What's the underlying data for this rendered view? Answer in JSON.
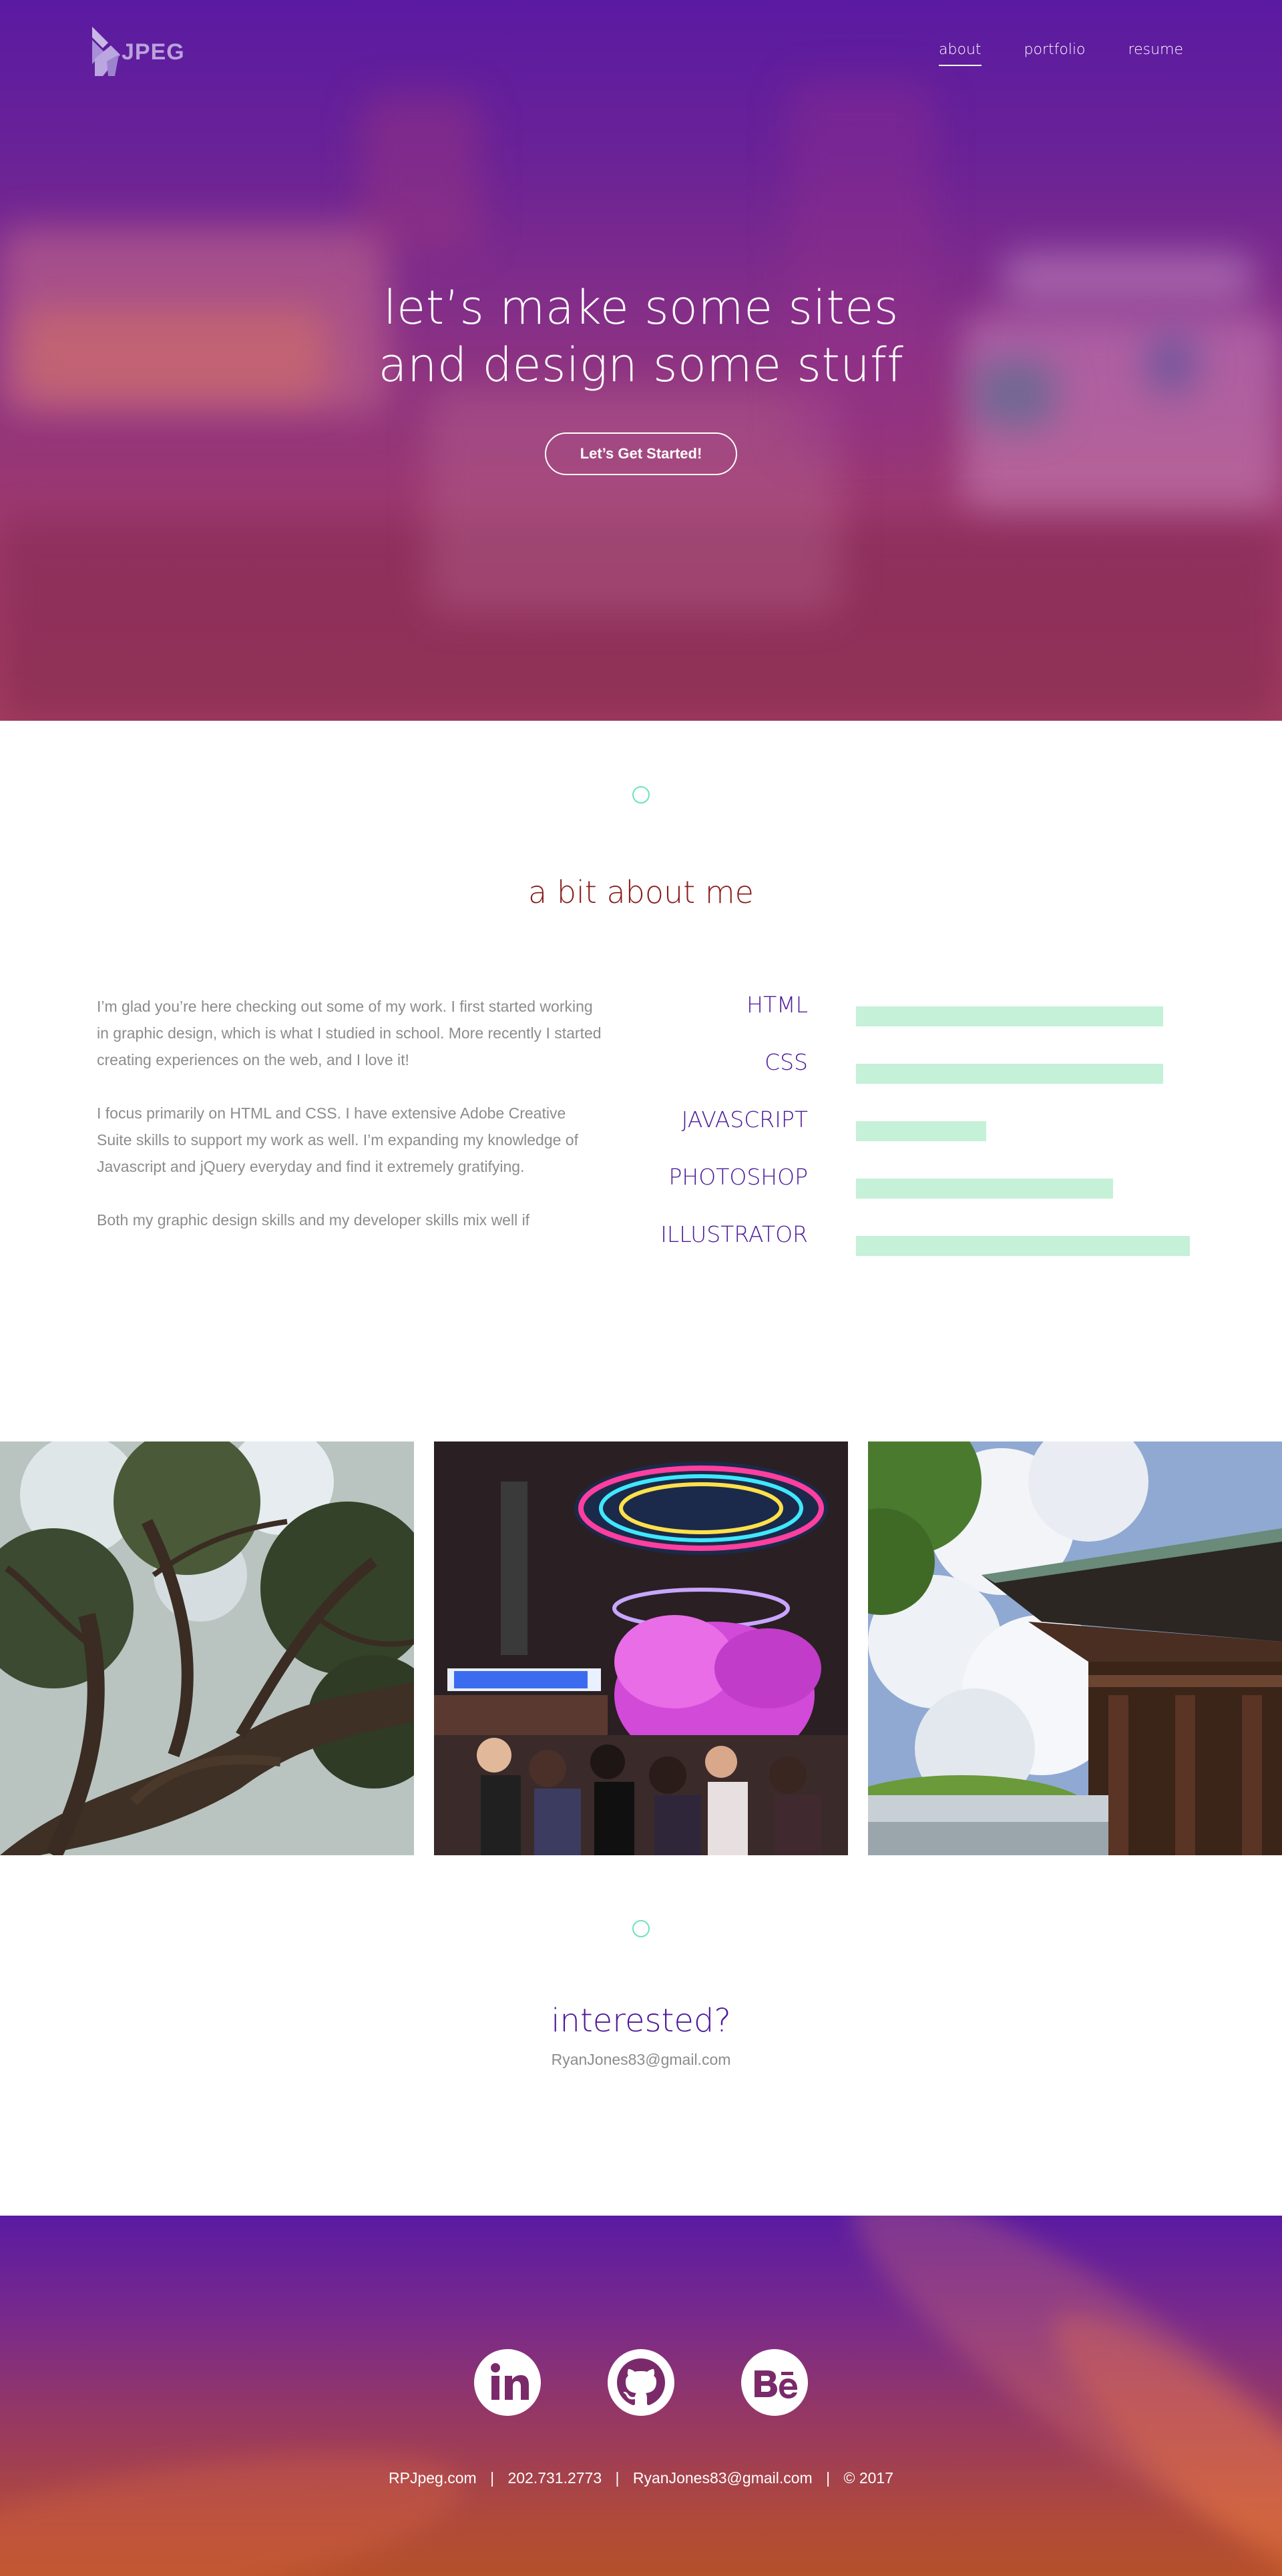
{
  "brand": {
    "logo_text": "JPEG"
  },
  "nav": {
    "items": [
      {
        "label": "about"
      },
      {
        "label": "portfolio"
      },
      {
        "label": "resume"
      }
    ]
  },
  "hero": {
    "title_line1": "let’s make some sites",
    "title_line2": "and design some stuff",
    "cta_label": "Let’s Get Started!"
  },
  "about": {
    "title": "a bit about me",
    "paragraphs": [
      "I’m glad you’re here checking out some of my work. I first started working in graphic design, which is what I studied in school. More recently I started creating experiences on the web, and I love it!",
      "I focus primarily on HTML and CSS. I have extensive Adobe Creative Suite skills to support my work as well. I’m expanding my knowledge of Javascript and jQuery everyday and find it extremely gratifying.",
      "Both my graphic design skills and my developer skills mix well if"
    ],
    "skills": [
      {
        "label": "HTML",
        "level": 0.92
      },
      {
        "label": "CSS",
        "level": 0.92
      },
      {
        "label": "JAVASCRIPT",
        "level": 0.39
      },
      {
        "label": "PHOTOSHOP",
        "level": 0.77
      },
      {
        "label": "ILLUSTRATOR",
        "level": 1.0
      }
    ]
  },
  "gallery": {
    "photos": [
      {
        "subject": "tree-photo"
      },
      {
        "subject": "arcade-photo"
      },
      {
        "subject": "temple-photo"
      }
    ]
  },
  "contact": {
    "title": "interested?",
    "email": "RyanJones83@gmail.com"
  },
  "footer": {
    "social": [
      {
        "icon": "linkedin-icon"
      },
      {
        "icon": "github-icon"
      },
      {
        "icon": "behance-icon"
      }
    ],
    "site": "RPJpeg.com",
    "phone": "202.731.2773",
    "email": "RyanJones83@gmail.com",
    "copyright": "© 2017",
    "separator": "|"
  },
  "colors": {
    "accent_purple": "#4b1a99",
    "about_title": "#8a1d1d",
    "skill_bar": "#c4f1d8",
    "ring": "#6fe3b6",
    "body_text": "#8c8c8c"
  }
}
